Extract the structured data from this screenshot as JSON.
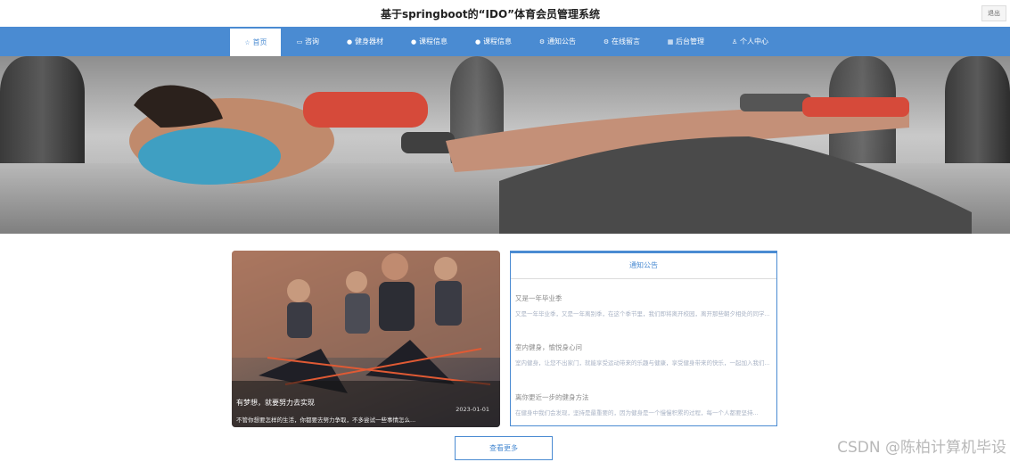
{
  "header": {
    "site_title": "基于springboot的“IDO”体育会员管理系统",
    "logout_label": "退出"
  },
  "nav": {
    "items": [
      {
        "label": "首页",
        "icon": "star-icon",
        "active": true
      },
      {
        "label": "咨询",
        "icon": "doc-icon"
      },
      {
        "label": "健身器材",
        "icon": "circle-icon"
      },
      {
        "label": "课程信息",
        "icon": "circle-icon"
      },
      {
        "label": "课程信息",
        "icon": "circle-icon"
      },
      {
        "label": "通知公告",
        "icon": "gear-icon"
      },
      {
        "label": "在线留言",
        "icon": "gear-icon"
      },
      {
        "label": "后台管理",
        "icon": "grid-icon"
      },
      {
        "label": "个人中心",
        "icon": "user-icon"
      }
    ]
  },
  "carousel": {
    "slide_count": 3,
    "active_index": 0
  },
  "featured": {
    "title": "有梦想，就要努力去实现",
    "date": "2023-01-01",
    "description": "不管你想要怎样的生活，你都要去努力争取，不多尝试一些事情怎么..."
  },
  "notice_board": {
    "title": "通知公告",
    "items": [
      {
        "title": "又是一年毕业季",
        "desc": "又是一年毕业季，又是一年离别季，在这个季节里，我们即将离开校园，离开那些朝夕相处的同学..."
      },
      {
        "title": "室内健身，愉悦身心问",
        "desc": "室内健身，让您不出家门，就能享受运动带来的乐趣与健康，享受健身带来的快乐，一起加入我们..."
      },
      {
        "title": "离你更近一步的健身方法",
        "desc": "在健身中我们会发现，坚持是最重要的，因为健身是一个慢慢积累的过程，每一个人都要坚持..."
      }
    ]
  },
  "more_button_label": "查看更多",
  "watermark": "CSDN @陈柏计算机毕设",
  "colors": {
    "accent": "#4a8bd2",
    "nav_text": "#ffffff"
  }
}
